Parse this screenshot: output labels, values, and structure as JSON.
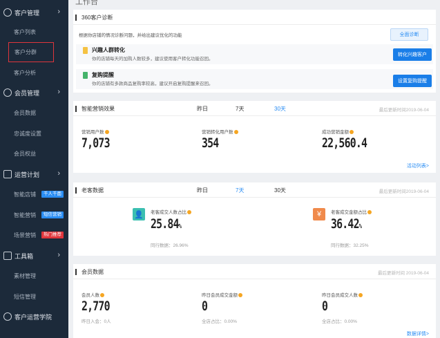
{
  "page": {
    "title": "工作台"
  },
  "sidebar": {
    "groups": [
      {
        "label": "客户管理",
        "icon": "customer-icon",
        "items": [
          "客户列表",
          "客户分群",
          "客户分析"
        ]
      },
      {
        "label": "会员管理",
        "icon": "member-icon",
        "items": [
          "会员数据",
          "忠诚度设置",
          "会员权益"
        ]
      },
      {
        "label": "运营计划",
        "icon": "plan-icon",
        "items": [
          "智能店铺",
          "智能营销",
          "场景营销"
        ]
      },
      {
        "label": "工具箱",
        "icon": "toolbox-icon",
        "items": [
          "素材管理",
          "短信管理"
        ]
      },
      {
        "label": "客户运营学院",
        "icon": "academy-icon",
        "items": []
      }
    ],
    "tags": {
      "smart_store": "千人千面",
      "smart_marketing": "短信营销",
      "scene_marketing": "热门推荐"
    },
    "tag_colors": {
      "smart_store": "#2a8df3",
      "smart_marketing": "#2a8df3",
      "scene_marketing": "#e0353c"
    }
  },
  "diagnosis": {
    "title": "360客户诊断",
    "intro": "根据你店铺的情况诊断问题，并给出建议优化的功能",
    "button": "全面诊断",
    "rows": [
      {
        "title": "兴趣人群转化",
        "desc": "你的店铺每天的加购人数较多，建议使用客户转化功能召回。",
        "button": "转化兴趣客户",
        "mark_color": "#f5c242"
      },
      {
        "title": "复购提醒",
        "desc": "你的店铺有多款商品复购率较高，建议开启复购提醒来召回。",
        "button": "设置复购提醒",
        "mark_color": "#45b36b"
      }
    ]
  },
  "smart_marketing": {
    "title": "智能营销效果",
    "periods": [
      "昨日",
      "7天",
      "30天"
    ],
    "active_period": "30天",
    "updated": "最后更新时间2019-06-04",
    "metrics": [
      {
        "label": "营销用户数",
        "value": "7,073"
      },
      {
        "label": "营销转化用户数",
        "value": "354"
      },
      {
        "label": "成功营销金额",
        "value": "22,560.4"
      }
    ],
    "link": "活动列表>"
  },
  "old_customer": {
    "title": "老客数据",
    "periods": [
      "昨日",
      "7天",
      "30天"
    ],
    "active_period": "7天",
    "updated": "最后更新时间2019-06-04",
    "metrics": [
      {
        "label": "老客成交人数占比",
        "value": "25.84",
        "unit": "%",
        "peer": "同行数据：26.96%",
        "icon": "user-icon",
        "glyph": "👤",
        "color": "#3bbfb1"
      },
      {
        "label": "老客成交金额占比",
        "value": "36.42",
        "unit": "%",
        "peer": "同行数据：32.25%",
        "icon": "yen-icon",
        "glyph": "¥",
        "color": "#f08a4b"
      }
    ]
  },
  "member": {
    "title": "会员数据",
    "updated": "最后更新时间 2019-06-04",
    "metrics": [
      {
        "label": "会员人数",
        "value": "2,770",
        "sub": "昨日入会：0人"
      },
      {
        "label": "昨日会员成交金额",
        "value": "0",
        "sub": "全店占比：0.00%"
      },
      {
        "label": "昨日会员成交人数",
        "value": "0",
        "sub": "全店占比：0.00%"
      }
    ],
    "link": "数据详情>"
  }
}
